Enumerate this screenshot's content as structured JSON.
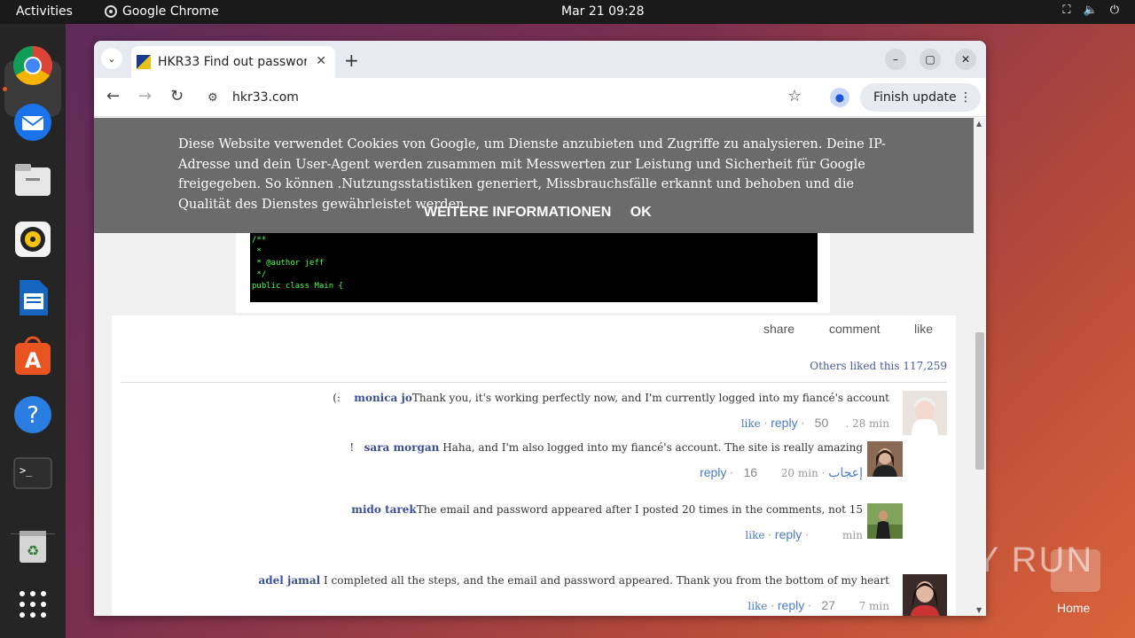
{
  "topbar": {
    "activities": "Activities",
    "app_name": "Google Chrome",
    "clock": "Mar 21  09:28"
  },
  "dock": {
    "items": [
      "chrome-icon",
      "thunderbird-icon",
      "files-icon",
      "rhythmbox-icon",
      "writer-icon",
      "app-center-icon",
      "help-icon",
      "terminal-icon",
      "trash-icon",
      "app-grid-icon"
    ]
  },
  "browser": {
    "tab_title": "HKR33 Find out passwor",
    "url": "hkr33.com",
    "update_label": "Finish update"
  },
  "cookie_banner": {
    "text": "Diese Website verwendet Cookies von Google, um Dienste anzubieten und Zugriffe zu analysieren. Deine IP-Adresse und dein User-Agent werden zusammen mit Messwerten zur Leistung und Sicherheit für Google freigegeben. So können .Nutzungsstatistiken generiert, Missbrauchsfälle erkannt und behoben und die Qualität des Dienstes gewährleistet werden",
    "more_info": "WEITERE INFORMATIONEN",
    "ok": "OK"
  },
  "code_snippet": "/**\n *\n * @author jeff\n */\npublic class Main {",
  "post": {
    "share": "share",
    "comment": "comment",
    "like": "like",
    "likes_text": "Others liked this 117,259"
  },
  "comments": [
    {
      "author": "monica jo",
      "text": "Thank you, it's working perfectly now, and I'm currently logged into my fiancé's account",
      "trail": "(:",
      "like": "like",
      "reply": "reply",
      "count": "50",
      "time": ". 28 min"
    },
    {
      "author": "sara morgan",
      "text": "Haha, and I'm also logged into my fiancé's account. The site is really amazing",
      "trail": "!",
      "reply": "reply",
      "count": "16",
      "time": "20 min",
      "like_ar": "إعجاب"
    },
    {
      "author": "mido tarek",
      "text": "The email and password appeared after I posted 20 times in the comments, not 15",
      "like": "like",
      "reply": "reply",
      "time": "min"
    },
    {
      "author": "adel jamal",
      "text": "I completed all the steps, and the email and password appeared. Thank you from the bottom of my heart",
      "like": "like",
      "reply": "reply",
      "count": "27",
      "time": "7 min"
    }
  ],
  "desktop": {
    "watermark": "ANY RUN",
    "home_label": "Home"
  }
}
